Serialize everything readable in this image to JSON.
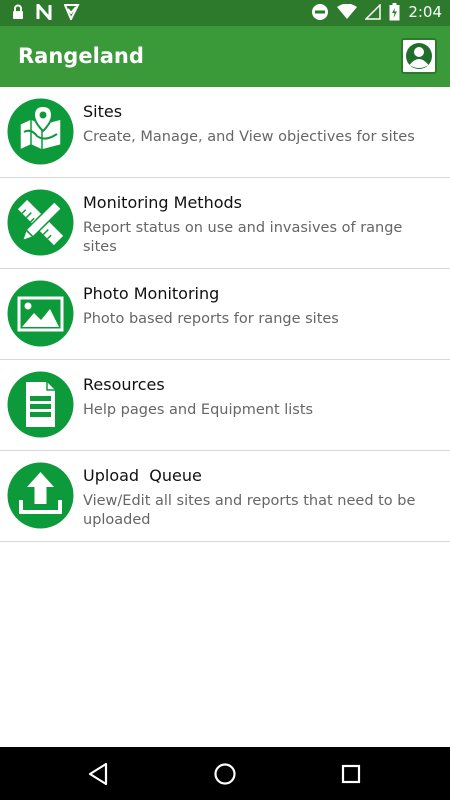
{
  "status_bar": {
    "time": "2:04",
    "left_icons": [
      "lock-icon",
      "n-notification-icon",
      "check-notification-icon"
    ],
    "right_icons": [
      "dnd-icon",
      "wifi-icon",
      "signal-icon",
      "battery-icon"
    ]
  },
  "app_bar": {
    "title": "Rangeland",
    "profile_icon": "profile-icon"
  },
  "menu": {
    "items": [
      {
        "title": "Sites",
        "subtitle": "Create, Manage, and View objectives for sites",
        "icon": "map-pin-icon"
      },
      {
        "title": "Monitoring Methods",
        "subtitle": "Report status on use and invasives of range sites",
        "icon": "ruler-pencil-icon"
      },
      {
        "title": "Photo Monitoring",
        "subtitle": "Photo based reports for range sites",
        "icon": "image-icon"
      },
      {
        "title": "Resources",
        "subtitle": "Help pages and Equipment lists",
        "icon": "document-icon"
      },
      {
        "title": "Upload  Queue",
        "subtitle": "View/Edit all sites and reports that need to be uploaded",
        "icon": "upload-icon"
      }
    ]
  },
  "nav": {
    "buttons": [
      "back-icon",
      "home-icon",
      "recents-icon"
    ]
  },
  "colors": {
    "status_bar": "#2d7a2d",
    "app_bar": "#3a9a3a",
    "icon_green": "#0d9a3a",
    "divider": "#d8d8d8"
  }
}
